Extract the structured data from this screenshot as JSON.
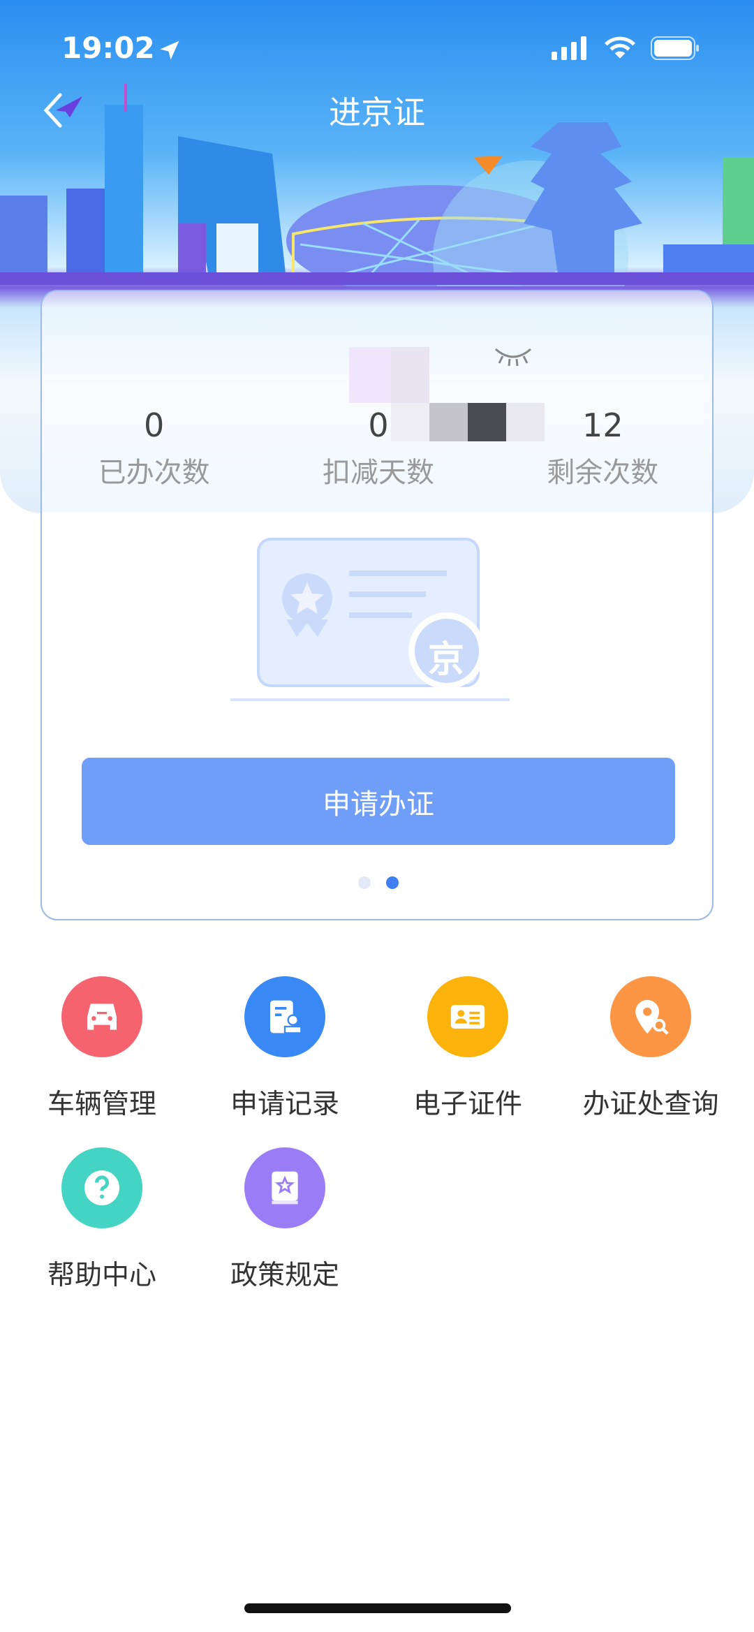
{
  "status_bar": {
    "time": "19:02"
  },
  "nav": {
    "title": "进京证"
  },
  "card": {
    "stats": [
      {
        "value": "0",
        "label": "已办次数"
      },
      {
        "value": "0",
        "label": "扣减天数"
      },
      {
        "value": "12",
        "label": "剩余次数"
      }
    ],
    "badge_char": "京",
    "apply_label": "申请办证",
    "page_dots": {
      "count": 2,
      "active": 2
    }
  },
  "menu": [
    {
      "label": "车辆管理",
      "icon": "car-icon",
      "color": "#f5636e"
    },
    {
      "label": "申请记录",
      "icon": "record-stamp-icon",
      "color": "#3a88f3"
    },
    {
      "label": "电子证件",
      "icon": "id-card-icon",
      "color": "#fbb30b"
    },
    {
      "label": "办证处查询",
      "icon": "location-search-icon",
      "color": "#fd9644"
    },
    {
      "label": "帮助中心",
      "icon": "help-icon",
      "color": "#44d4c4"
    },
    {
      "label": "政策规定",
      "icon": "policy-book-icon",
      "color": "#9a7cf6"
    }
  ]
}
